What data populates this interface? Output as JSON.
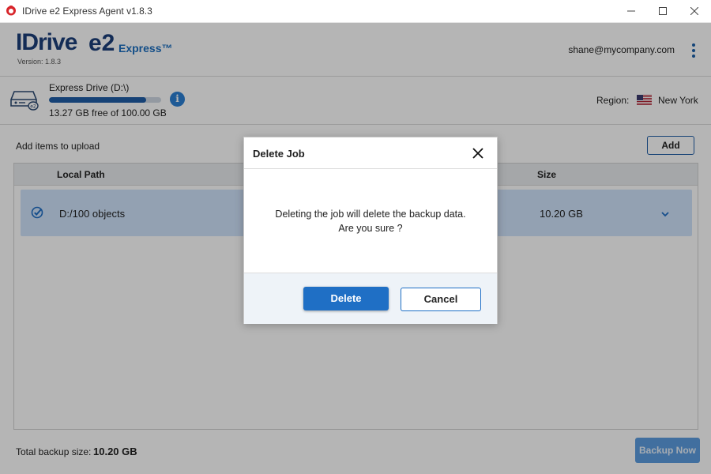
{
  "window": {
    "title": "IDrive e2 Express Agent v1.8.3",
    "icon": "idrive-app-icon",
    "controls": [
      "minimize-icon",
      "maximize-icon",
      "close-icon"
    ]
  },
  "header": {
    "logo_brand": "IDrive",
    "logo_product": "e2",
    "logo_edition": "Express™",
    "version": "Version: 1.8.3",
    "user_email": "shane@mycompany.com",
    "menu_icon": "kebab-menu-icon"
  },
  "drive": {
    "name": "Express Drive (D:\\)",
    "free_text": "13.27 GB free of 100.00 GB",
    "usage_fraction": 0.867,
    "info_icon": "info-icon",
    "region_label": "Region:",
    "region_value": "New York",
    "region_flag": "us-flag-icon"
  },
  "main": {
    "add_items_label": "Add items to upload",
    "add_button": "Add",
    "columns": {
      "local_path": "Local Path",
      "size": "Size"
    },
    "rows": [
      {
        "path": "D:/100 objects",
        "size": "10.20 GB",
        "checked": true
      }
    ],
    "footer_label": "Total backup size:",
    "footer_value": "10.20 GB",
    "backup_button": "Backup Now"
  },
  "dialog": {
    "title": "Delete Job",
    "message_line1": "Deleting the job will delete the backup data.",
    "message_line2": "Are you sure ?",
    "confirm_button": "Delete",
    "cancel_button": "Cancel"
  },
  "colors": {
    "brand_navy": "#1c3f7a",
    "accent_blue": "#1f6fc5",
    "row_selected": "#cfe3fb",
    "backup_disabled": "#5c9de0"
  }
}
